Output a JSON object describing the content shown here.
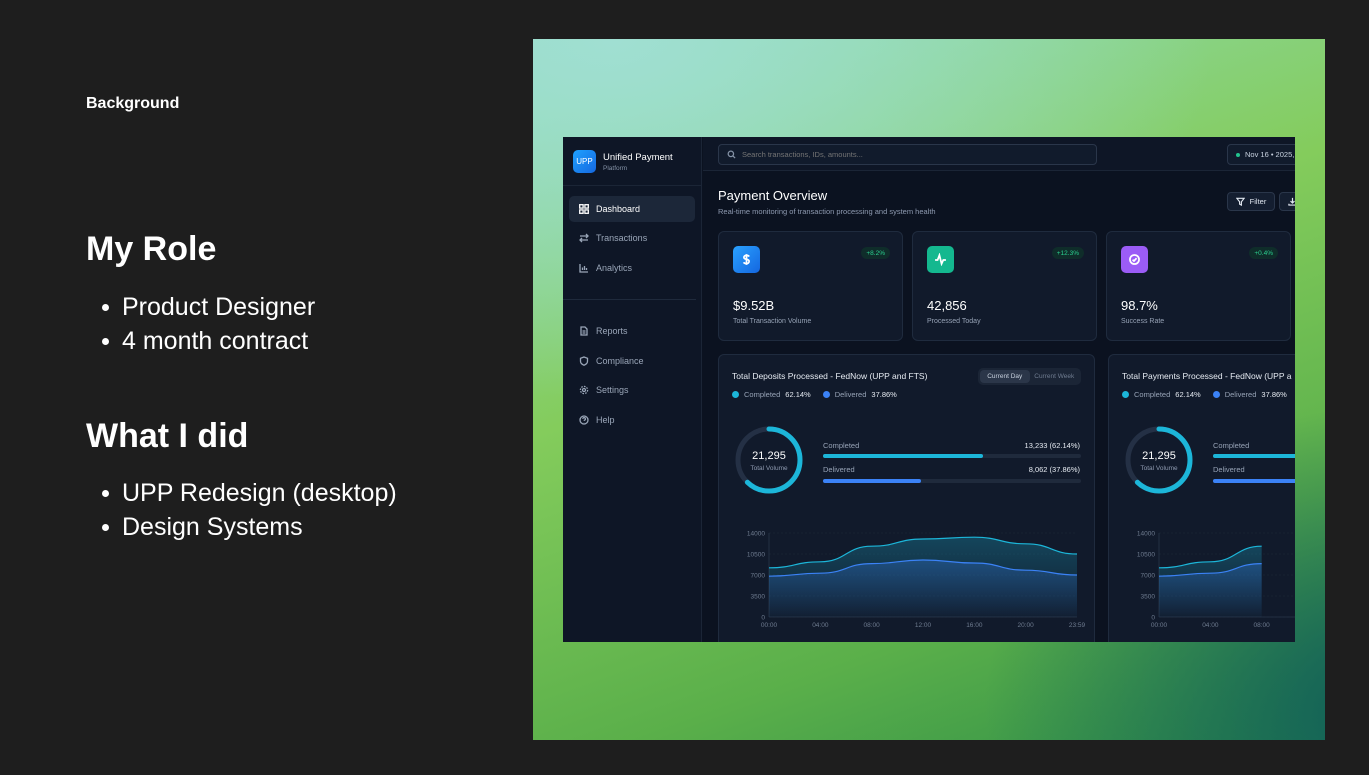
{
  "slide": {
    "eyebrow": "Background",
    "role_heading": "My Role",
    "role_items": [
      "Product Designer",
      "4 month contract"
    ],
    "did_heading": "What I did",
    "did_items": [
      "UPP Redesign (desktop)",
      "Design Systems"
    ]
  },
  "app": {
    "brand": {
      "logo": "UPP",
      "title": "Unified Payment",
      "subtitle": "Platform"
    },
    "nav": [
      {
        "label": "Dashboard",
        "icon": "grid-icon",
        "active": true
      },
      {
        "label": "Transactions",
        "icon": "arrows-icon"
      },
      {
        "label": "Analytics",
        "icon": "bar-chart-icon"
      },
      {
        "label": "Reports",
        "icon": "document-icon"
      },
      {
        "label": "Compliance",
        "icon": "shield-icon"
      },
      {
        "label": "Settings",
        "icon": "gear-icon"
      },
      {
        "label": "Help",
        "icon": "help-icon"
      }
    ],
    "search_placeholder": "Search transactions, IDs, amounts...",
    "date_text": "Nov 16 • 2025,",
    "title": "Payment Overview",
    "subtitle": "Real-time monitoring of transaction processing and system health",
    "filter_label": "Filter",
    "kpis": [
      {
        "value": "$9.52B",
        "label": "Total Transaction Volume",
        "badge": "+8.2%",
        "icon": "dollar-icon",
        "color": "#1e8fff"
      },
      {
        "value": "42,856",
        "label": "Processed Today",
        "badge": "+12.3%",
        "icon": "activity-icon",
        "color": "#14b88f"
      },
      {
        "value": "98.7%",
        "label": "Success Rate",
        "badge": "+0.4%",
        "icon": "check-circle-icon",
        "color": "#9b5cf6"
      }
    ],
    "panels": [
      {
        "title": "Total Deposits Processed - FedNow (UPP and FTS)",
        "toggle": [
          "Current Day",
          "Current Week"
        ],
        "legend": [
          {
            "name": "Completed",
            "value": "62.14%",
            "color": "#1cb6d9"
          },
          {
            "name": "Delivered",
            "value": "37.86%",
            "color": "#3b82f6"
          }
        ],
        "donut": {
          "value": "21,295",
          "label": "Total Volume",
          "completed_fraction": 0.6214
        },
        "bars": [
          {
            "label": "Completed",
            "value": "13,233 (62.14%)",
            "fraction": 0.6214,
            "color": "#1cb6d9"
          },
          {
            "label": "Delivered",
            "value": "8,062 (37.86%)",
            "fraction": 0.3786,
            "color": "#3b82f6"
          }
        ]
      },
      {
        "title": "Total Payments Processed - FedNow (UPP a",
        "legend": [
          {
            "name": "Completed",
            "value": "62.14%",
            "color": "#1cb6d9"
          },
          {
            "name": "Delivered",
            "value": "37.86%",
            "color": "#3b82f6"
          }
        ],
        "donut": {
          "value": "21,295",
          "label": "Total Volume",
          "completed_fraction": 0.6214
        },
        "bars": [
          {
            "label": "Completed",
            "value": "",
            "fraction": 0.6214,
            "color": "#1cb6d9"
          },
          {
            "label": "Delivered",
            "value": "",
            "fraction": 0.3786,
            "color": "#3b82f6"
          }
        ]
      }
    ]
  },
  "chart_data": [
    {
      "type": "area",
      "x": [
        "00:00",
        "04:00",
        "08:00",
        "12:00",
        "16:00",
        "20:00",
        "23:59"
      ],
      "y_ticks": [
        "14000",
        "10500",
        "7000",
        "3500",
        "0"
      ],
      "ylim": [
        0,
        14000
      ],
      "series": [
        {
          "values": [
            8200,
            9200,
            11800,
            13000,
            13300,
            12200,
            10500
          ],
          "color": "#1cb6d9"
        },
        {
          "values": [
            6800,
            7300,
            8900,
            9500,
            9000,
            7800,
            7000
          ],
          "color": "#3b82f6"
        }
      ]
    },
    {
      "type": "area",
      "x": [
        "00:00",
        "04:00",
        "08:00"
      ],
      "y_ticks": [
        "14000",
        "10500",
        "7000",
        "3500",
        "0"
      ],
      "ylim": [
        0,
        14000
      ],
      "series": [
        {
          "values": [
            8200,
            9200,
            11800
          ],
          "color": "#1cb6d9"
        },
        {
          "values": [
            6800,
            7300,
            8900
          ],
          "color": "#3b82f6"
        }
      ]
    }
  ]
}
